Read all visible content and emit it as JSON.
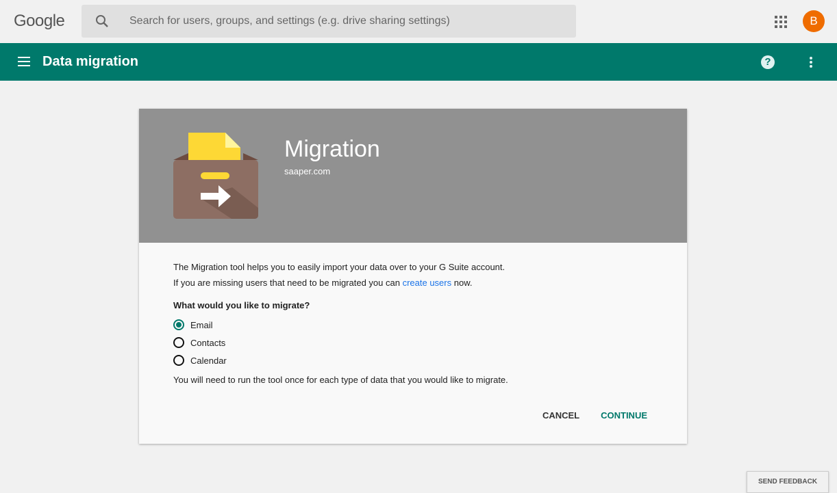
{
  "header": {
    "logo": "Google",
    "search_placeholder": "Search for users, groups, and settings (e.g. drive sharing settings)",
    "avatar_letter": "B"
  },
  "appbar": {
    "title": "Data migration"
  },
  "card": {
    "title": "Migration",
    "domain": "saaper.com",
    "intro1": "The Migration tool helps you to easily import your data over to your G Suite account.",
    "intro2_pre": "If you are missing users that need to be migrated you can ",
    "intro2_link": "create users",
    "intro2_post": " now.",
    "question": "What would you like to migrate?",
    "options": [
      {
        "label": "Email",
        "selected": true
      },
      {
        "label": "Contacts",
        "selected": false
      },
      {
        "label": "Calendar",
        "selected": false
      }
    ],
    "note": "You will need to run the tool once for each type of data that you would like to migrate.",
    "cancel": "CANCEL",
    "continue": "CONTINUE"
  },
  "feedback": "SEND FEEDBACK"
}
